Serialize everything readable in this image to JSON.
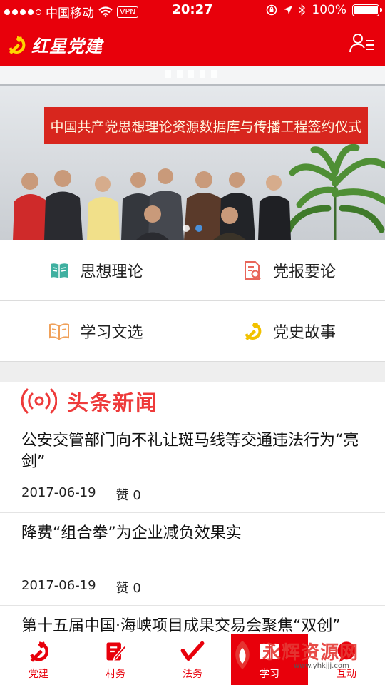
{
  "status_bar": {
    "carrier": "中国移动",
    "vpn": "VPN",
    "time": "20:27",
    "battery": "100%",
    "battery_level": 1.0
  },
  "header": {
    "app_title": "红星党建",
    "brand_color": "#e8000b"
  },
  "banner": {
    "sign_text": "中国共产党思想理论资源数据库与传播工程签约仪式",
    "slides": 2,
    "active_slide": 2
  },
  "categories": [
    {
      "label": "思想理论",
      "icon": "book-icon",
      "color": "#3fb0a0"
    },
    {
      "label": "党报要论",
      "icon": "document-search-icon",
      "color": "#e8665a"
    },
    {
      "label": "学习文选",
      "icon": "open-book-icon",
      "color": "#f0a15a"
    },
    {
      "label": "党史故事",
      "icon": "party-emblem-icon",
      "color": "#f2c200"
    }
  ],
  "headlines": {
    "title": "头条新闻",
    "accent": "#ee3a3a",
    "items": [
      {
        "title": "公安交管部门向不礼让斑马线等交通违法行为“亮剑”",
        "date": "2017-06-19",
        "likes": "赞 0"
      },
      {
        "title": "降费“组合拳”为企业减负效果实",
        "date": "2017-06-19",
        "likes": "赞 0"
      },
      {
        "title": "第十五届中国·海峡项目成果交易会聚焦“双创”",
        "date": "",
        "likes": ""
      }
    ]
  },
  "tab_bar": {
    "tabs": [
      {
        "label": "党建",
        "icon": "party-emblem-icon"
      },
      {
        "label": "村务",
        "icon": "edit-note-icon"
      },
      {
        "label": "法务",
        "icon": "gavel-icon"
      },
      {
        "label": "学习",
        "icon": "study-icon"
      },
      {
        "label": "互动",
        "icon": "chat-icon"
      }
    ],
    "active": "学习"
  },
  "watermark": {
    "text": "永辉资源网",
    "url": "www.yhkjjj.com"
  }
}
